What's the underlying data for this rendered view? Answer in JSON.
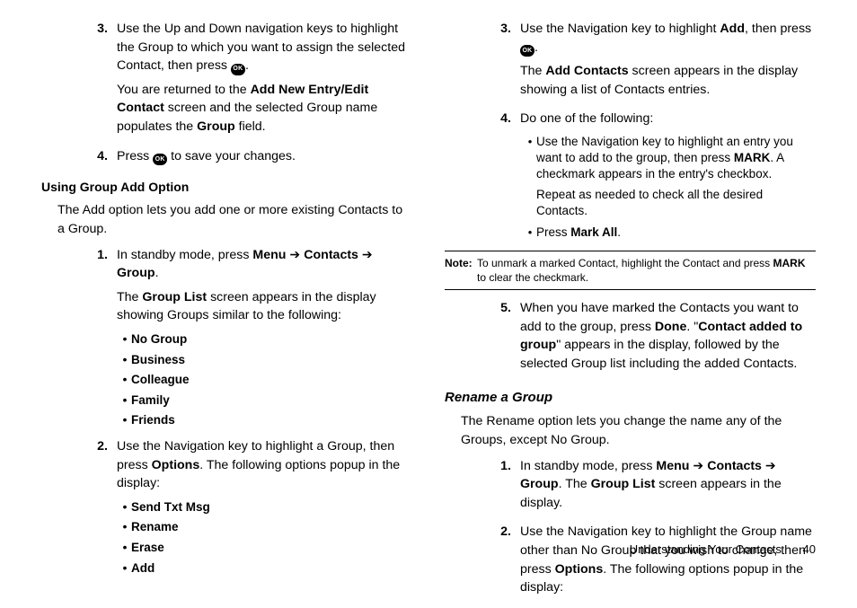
{
  "ok_label": "OK",
  "left": {
    "s3_a": "Use the Up and Down navigation keys to highlight the Group to which you want to assign the selected Contact, then press ",
    "s3_b": ".",
    "s3_c1": "You are returned to the ",
    "s3_c_bold": "Add New Entry/Edit Contact",
    "s3_c2": " screen and the selected Group name populates the ",
    "s3_c_bold2": "Group",
    "s3_c3": " field.",
    "s4_a": "Press ",
    "s4_b": " to save your changes.",
    "h4": "Using Group Add Option",
    "intro": "The Add option lets you add one or more existing Contacts to a Group.",
    "s1_a": "In standby mode, press ",
    "s1_menu": "Menu",
    "arrow": " ➔ ",
    "s1_contacts": "Contacts",
    "s1_group": "Group",
    "s1_end": ".",
    "s1_b1": "The ",
    "s1_b_bold": "Group List",
    "s1_b2": " screen appears in the display showing Groups similar to the following:",
    "groups": [
      "No Group",
      "Business",
      "Colleague",
      "Family",
      "Friends"
    ],
    "s2_a": "Use the Navigation key to highlight a Group, then press ",
    "s2_bold": "Options",
    "s2_b": ". The following options popup in the display:",
    "opts": [
      "Send Txt Msg",
      "Rename",
      "Erase",
      "Add"
    ]
  },
  "right": {
    "s3_a": "Use the Navigation key to highlight ",
    "s3_add": "Add",
    "s3_b": ", then press ",
    "s3_c": ".",
    "s3_d1": "The ",
    "s3_d_bold": "Add Contacts",
    "s3_d2": " screen appears in the display showing a list of Contacts entries.",
    "s4": "Do one of the following:",
    "sb1_a": "Use the Navigation key to highlight an entry you want to add to the group, then press ",
    "sb1_mark": "MARK",
    "sb1_b": ". A checkmark appears in the entry's checkbox.",
    "sb1_c": "Repeat as needed to check all the desired Contacts.",
    "sb2_a": "Press ",
    "sb2_bold": "Mark All",
    "sb2_b": ".",
    "note_label": "Note:",
    "note_a": "To unmark a marked Contact, highlight the Contact and press ",
    "note_mark": "MARK",
    "note_b": " to clear the checkmark.",
    "s5_a": "When you have marked the Contacts you want to add to the group, press ",
    "s5_done": "Done",
    "s5_b": ". \"",
    "s5_bold2": "Contact added to group",
    "s5_c": "\" appears in the display, followed by the selected Group list including the added Contacts.",
    "h3": "Rename a Group",
    "intro": "The Rename option lets you change the name any of the Groups, except No Group.",
    "r1_a": "In standby mode, press ",
    "r1_menu": "Menu",
    "r1_contacts": "Contacts",
    "r1_group": "Group",
    "r1_b": ". The ",
    "r1_bold": "Group List",
    "r1_c": " screen appears in the display.",
    "r2_a": "Use the Navigation key to highlight the Group name other than No Group that you wish to change, then press ",
    "r2_bold": "Options",
    "r2_b": ". The following options popup in the display:"
  },
  "footer": {
    "section": "Understanding Your Contacts",
    "page": "40"
  }
}
